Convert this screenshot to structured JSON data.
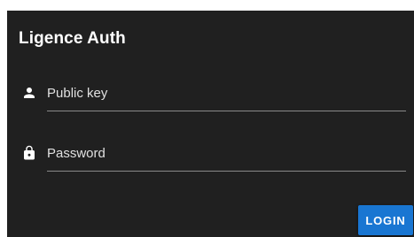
{
  "dialog": {
    "title": "Ligence Auth"
  },
  "fields": {
    "public_key": {
      "icon": "person-icon",
      "placeholder": "Public key",
      "value": ""
    },
    "password": {
      "icon": "lock-icon",
      "placeholder": "Password",
      "value": ""
    }
  },
  "actions": {
    "login_label": "LOGIN"
  },
  "colors": {
    "dialog_background": "#202020",
    "accent": "#1976d2",
    "underline": "#8a8a8a",
    "text": "#ffffff"
  }
}
